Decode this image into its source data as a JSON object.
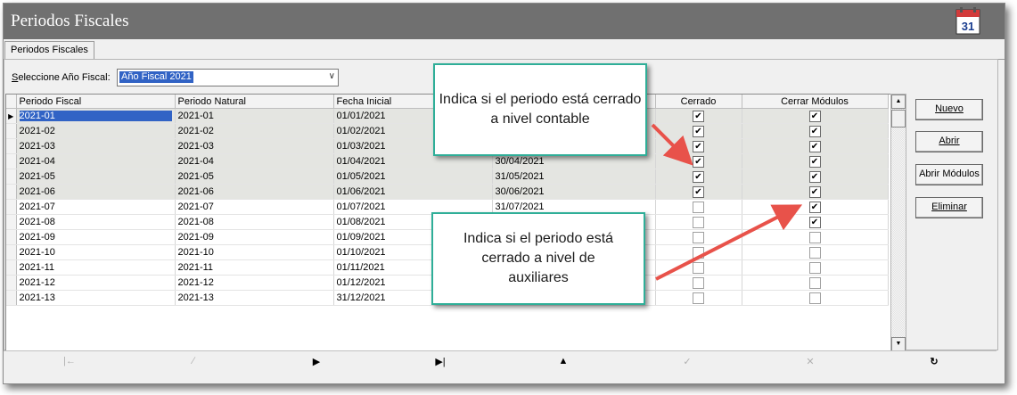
{
  "window": {
    "title": "Periodos Fiscales",
    "calendar_icon_text": "31"
  },
  "tabs": [
    {
      "label": "Periodos Fiscales"
    }
  ],
  "selector": {
    "label_prefix": "S",
    "label_rest": "eleccione Año Fiscal:",
    "value": "Año Fiscal 2021"
  },
  "grid": {
    "columns": [
      "Periodo Fiscal",
      "Periodo Natural",
      "Fecha Inicial",
      "",
      "Cerrado",
      "Cerrar Módulos"
    ],
    "rows": [
      {
        "periodo_fiscal": "2021-01",
        "periodo_natural": "2021-01",
        "fecha_inicial": "01/01/2021",
        "fecha_final": "",
        "cerrado": true,
        "cerrar_modulos": true
      },
      {
        "periodo_fiscal": "2021-02",
        "periodo_natural": "2021-02",
        "fecha_inicial": "01/02/2021",
        "fecha_final": "",
        "cerrado": true,
        "cerrar_modulos": true
      },
      {
        "periodo_fiscal": "2021-03",
        "periodo_natural": "2021-03",
        "fecha_inicial": "01/03/2021",
        "fecha_final": "",
        "cerrado": true,
        "cerrar_modulos": true
      },
      {
        "periodo_fiscal": "2021-04",
        "periodo_natural": "2021-04",
        "fecha_inicial": "01/04/2021",
        "fecha_final": "30/04/2021",
        "cerrado": true,
        "cerrar_modulos": true
      },
      {
        "periodo_fiscal": "2021-05",
        "periodo_natural": "2021-05",
        "fecha_inicial": "01/05/2021",
        "fecha_final": "31/05/2021",
        "cerrado": true,
        "cerrar_modulos": true
      },
      {
        "periodo_fiscal": "2021-06",
        "periodo_natural": "2021-06",
        "fecha_inicial": "01/06/2021",
        "fecha_final": "30/06/2021",
        "cerrado": true,
        "cerrar_modulos": true
      },
      {
        "periodo_fiscal": "2021-07",
        "periodo_natural": "2021-07",
        "fecha_inicial": "01/07/2021",
        "fecha_final": "31/07/2021",
        "cerrado": false,
        "cerrar_modulos": true
      },
      {
        "periodo_fiscal": "2021-08",
        "periodo_natural": "2021-08",
        "fecha_inicial": "01/08/2021",
        "fecha_final": "",
        "cerrado": false,
        "cerrar_modulos": true
      },
      {
        "periodo_fiscal": "2021-09",
        "periodo_natural": "2021-09",
        "fecha_inicial": "01/09/2021",
        "fecha_final": "",
        "cerrado": false,
        "cerrar_modulos": false
      },
      {
        "periodo_fiscal": "2021-10",
        "periodo_natural": "2021-10",
        "fecha_inicial": "01/10/2021",
        "fecha_final": "",
        "cerrado": false,
        "cerrar_modulos": false
      },
      {
        "periodo_fiscal": "2021-11",
        "periodo_natural": "2021-11",
        "fecha_inicial": "01/11/2021",
        "fecha_final": "",
        "cerrado": false,
        "cerrar_modulos": false
      },
      {
        "periodo_fiscal": "2021-12",
        "periodo_natural": "2021-12",
        "fecha_inicial": "01/12/2021",
        "fecha_final": "",
        "cerrado": false,
        "cerrar_modulos": false
      },
      {
        "periodo_fiscal": "2021-13",
        "periodo_natural": "2021-13",
        "fecha_inicial": "31/12/2021",
        "fecha_final": "",
        "cerrado": false,
        "cerrar_modulos": false
      }
    ]
  },
  "buttons": {
    "nuevo": "Nuevo",
    "abrir": "Abrir",
    "abrir_modulos": "Abrir Módulos",
    "eliminar": "Eliminar"
  },
  "callouts": {
    "contable": "Indica si el periodo está cerrado a nivel contable",
    "auxiliares": "Indica si el periodo está cerrado a nivel de auxiliares"
  },
  "colors": {
    "titlebar": "#707070",
    "closed_row": "#e4e5e1",
    "selection": "#3163c5",
    "callout_border": "#2fae98",
    "arrow": "#e8524a"
  }
}
